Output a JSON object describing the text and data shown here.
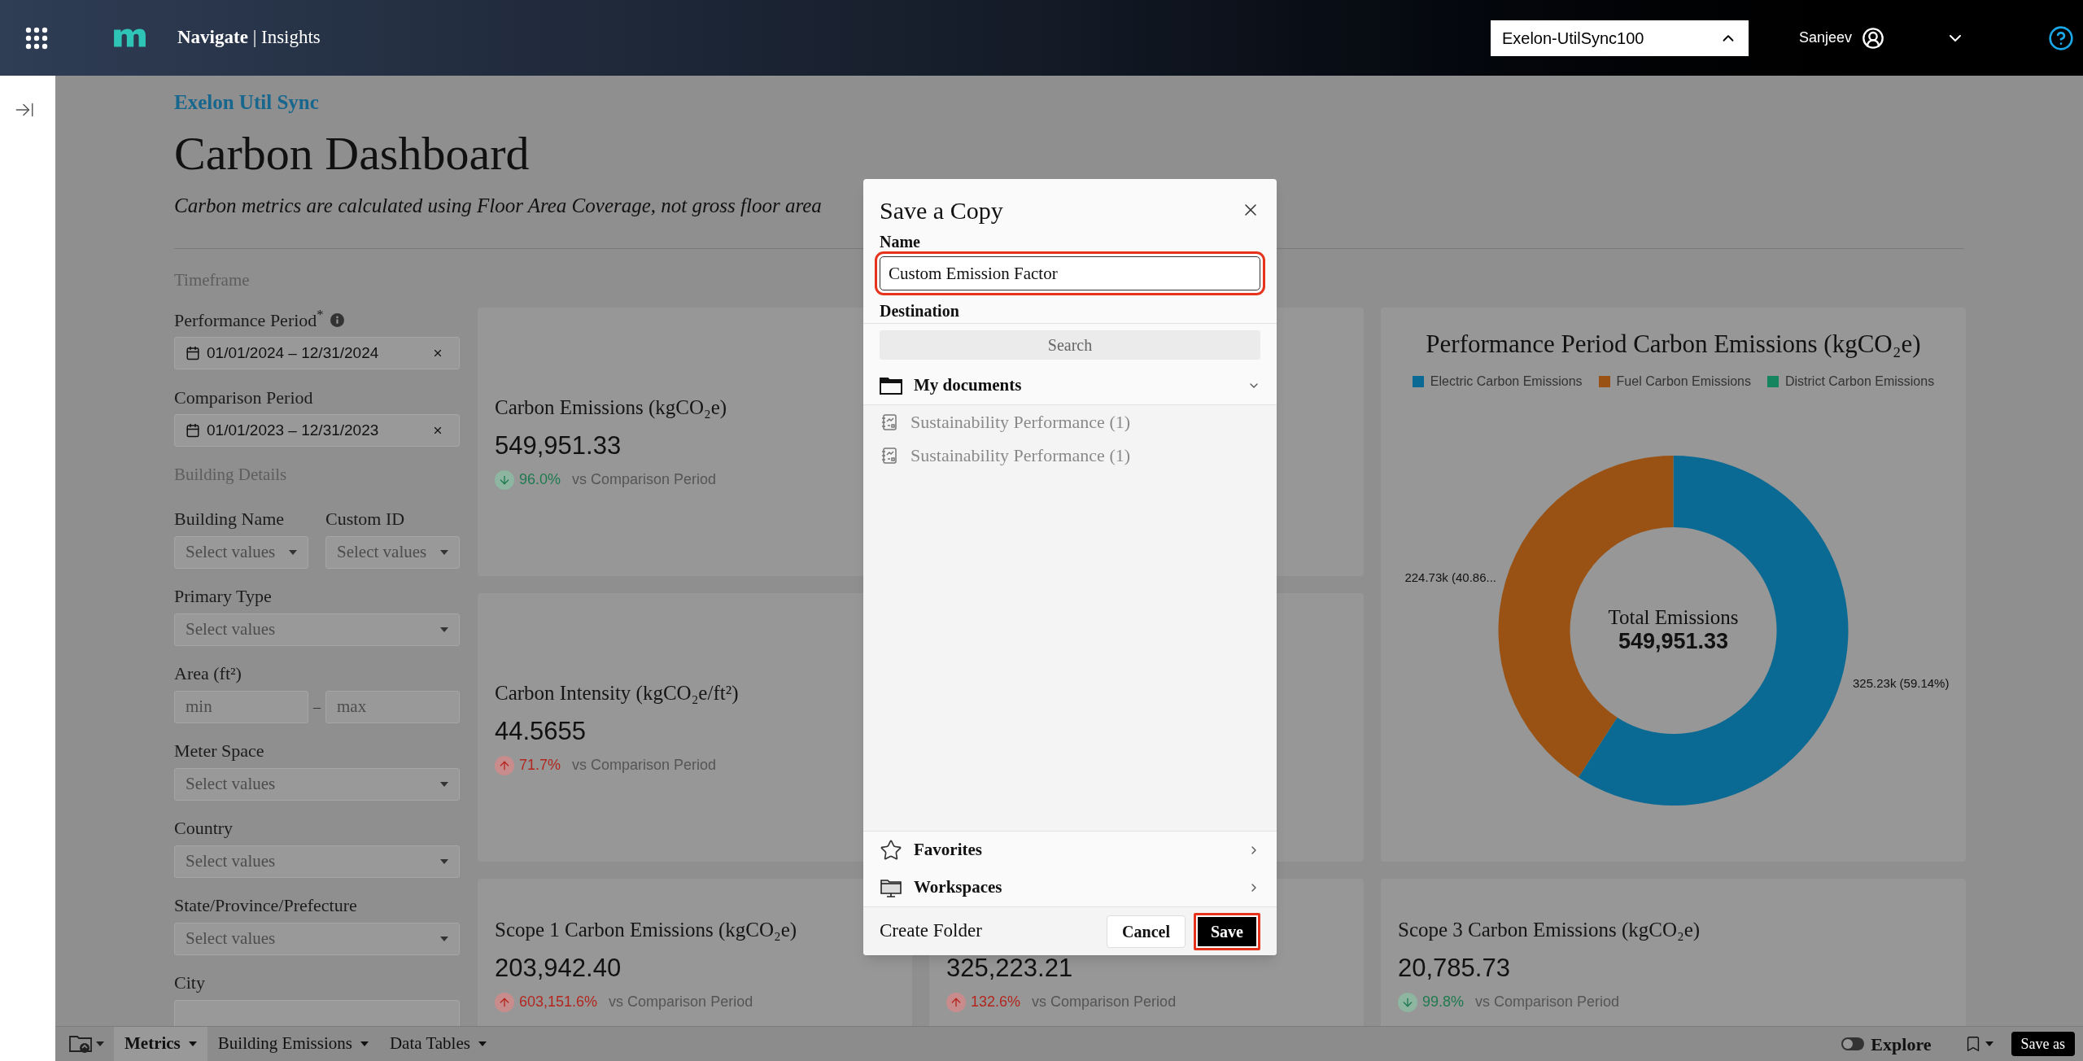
{
  "top_bar": {
    "app_title": "**Navigate** | Insights",
    "org_select": {
      "value": "Exelon-UtilSync100",
      "expanded": true
    },
    "user": {
      "name": "Sanjeev"
    }
  },
  "header": {
    "breadcrumb": "Exelon Util Sync",
    "title": "Carbon Dashboard",
    "subtitle": "Carbon metrics are calculated using Floor Area Coverage, not gross floor area"
  },
  "filters": [
    {
      "kind": "heading",
      "label": "Timeframe"
    },
    {
      "kind": "date",
      "label": "Performance Period$^{*}$",
      "info": true,
      "value": "01/01/2024 – 12/31/2024"
    },
    {
      "kind": "date",
      "label": "Comparison Period",
      "value": "01/01/2023 – 12/31/2023"
    },
    {
      "kind": "heading",
      "label": "Building Details"
    },
    {
      "kind": "select_pair",
      "fields": [
        {
          "label": "Building Name",
          "placeholder": "Select values"
        },
        {
          "label": "Custom ID",
          "placeholder": "Select values"
        }
      ]
    },
    {
      "kind": "select",
      "label": "Primary Type",
      "placeholder": "Select values"
    },
    {
      "kind": "range",
      "label": "Area (ft²)",
      "min_placeholder": "min",
      "separator": "–",
      "max_placeholder": "max"
    },
    {
      "kind": "select",
      "label": "Meter Space",
      "placeholder": "Select values"
    },
    {
      "kind": "select",
      "label": "Country",
      "placeholder": "Select values"
    },
    {
      "kind": "select",
      "label": "State/Province/Prefecture",
      "placeholder": "Select values"
    },
    {
      "kind": "select",
      "label": "City"
    }
  ],
  "card_columns": [
    {
      "cards": [
        {
          "kind": "kpi",
          "title": "Carbon Emissions (kgCO₂e)",
          "value": "549,951.33",
          "change": {
            "increase": false,
            "percent": "96.0%",
            "label": "vs Comparison Period"
          }
        },
        {
          "kind": "kpi",
          "title": "Carbon Intensity (kgCO₂e/ft²)",
          "value": "44.5655",
          "change": {
            "increase": true,
            "percent": "71.7%",
            "label": "vs Comparison Period"
          }
        },
        {
          "kind": "kpi",
          "title": "Scope 1 Carbon Emissions (kgCO₂e)",
          "value": "203,942.40",
          "change": {
            "increase": true,
            "percent": "603,151.6%",
            "label": "vs Comparison Period"
          }
        }
      ]
    },
    {
      "cards": [
        {
          "kind": "kpi"
        },
        {
          "kind": "kpi"
        },
        {
          "kind": "kpi",
          "value": "325,223.21",
          "change": {
            "increase": true,
            "percent": "132.6%",
            "label": "vs Comparison Period"
          }
        }
      ]
    },
    {
      "cards": [
        {
          "kind": "chart",
          "center_label": "Total Emissions",
          "center_value": "549,951.33",
          "chart_data": {
            "type": "donut",
            "title": "Performance Period Carbon Emissions (kgCO₂e)",
            "categories": [
              "Electric Carbon Emissions",
              "Fuel Carbon Emissions",
              "District Carbon Emissions"
            ],
            "colors": [
              "#0a6a94",
              "#9a5214",
              "#14855f"
            ],
            "values": [
              325230,
              224730,
              0
            ],
            "value_labels": [
              "325.23k (59.14%)",
              "224.73k (40.86...",
              null
            ]
          }
        },
        {
          "kind": "kpi",
          "title": "Scope 3 Carbon Emissions (kgCO₂e)",
          "value": "20,785.73",
          "change": {
            "increase": false,
            "percent": "99.8%",
            "label": "vs Comparison Period"
          }
        }
      ]
    }
  ],
  "dialog": {
    "title": "Save a Copy",
    "name_field": {
      "label": "Name",
      "value": "Custom Emission Factor",
      "highlighted": true
    },
    "destination_label": "Destination",
    "search": {
      "placeholder": "Search"
    },
    "folders": [
      {
        "kind": "documents",
        "label": "My documents",
        "expanded": true,
        "children": [
          {
            "label": "Sustainability Performance (1)",
            "disabled": true
          },
          {
            "label": "Sustainability Performance (1)",
            "disabled": true
          }
        ]
      }
    ],
    "sections": [
      {
        "kind": "favorites",
        "label": "Favorites",
        "expanded": false
      },
      {
        "kind": "workspaces",
        "label": "Workspaces",
        "expanded": false
      }
    ],
    "create_folder": "Create Folder",
    "buttons": [
      {
        "kind": "secondary",
        "label": "Cancel",
        "highlighted": false
      },
      {
        "kind": "primary",
        "label": "Save",
        "highlighted": true
      }
    ]
  },
  "bottom_bar": {
    "tabs": [
      {
        "label": "Metrics",
        "selected": true
      },
      {
        "label": "Building Emissions",
        "selected": false
      },
      {
        "label": "Data Tables",
        "selected": false
      }
    ],
    "explore": {
      "label": "Explore",
      "on": false
    },
    "save_as": "Save as"
  }
}
